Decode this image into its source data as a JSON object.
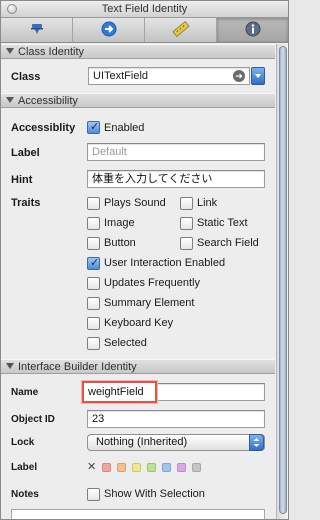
{
  "window": {
    "title": "Text Field Identity"
  },
  "toolbar": {
    "tabs": [
      {
        "icon": "attributes-icon"
      },
      {
        "icon": "connections-icon"
      },
      {
        "icon": "size-ruler-icon"
      },
      {
        "icon": "info-icon"
      }
    ],
    "active_tab": 3
  },
  "class_identity": {
    "header": "Class Identity",
    "class_label": "Class",
    "class_value": "UITextField"
  },
  "accessibility": {
    "header": "Accessibility",
    "accessibility_label": "Accessiblity",
    "enabled_label": "Enabled",
    "enabled_checked": true,
    "label_label": "Label",
    "label_placeholder": "Default",
    "hint_label": "Hint",
    "hint_value": "体重を入力してください",
    "traits_label": "Traits",
    "traits": [
      {
        "label": "Plays Sound",
        "checked": false
      },
      {
        "label": "Link",
        "checked": false
      },
      {
        "label": "Image",
        "checked": false
      },
      {
        "label": "Static Text",
        "checked": false
      },
      {
        "label": "Button",
        "checked": false
      },
      {
        "label": "Search Field",
        "checked": false
      },
      {
        "label": "User Interaction Enabled",
        "checked": true
      },
      {
        "label": "Updates Frequently",
        "checked": false
      },
      {
        "label": "Summary Element",
        "checked": false
      },
      {
        "label": "Keyboard Key",
        "checked": false
      },
      {
        "label": "Selected",
        "checked": false
      }
    ]
  },
  "ib_identity": {
    "header": "Interface Builder Identity",
    "name_label": "Name",
    "name_value": "weightField",
    "object_id_label": "Object ID",
    "object_id_value": "23",
    "lock_label": "Lock",
    "lock_value": "Nothing (Inherited)",
    "color_label_label": "Label",
    "color_none_glyph": "✕",
    "color_swatches": [
      "#f2a39a",
      "#f5c08a",
      "#efe98c",
      "#b9e38e",
      "#9fc4f2",
      "#d6a8e8",
      "#c6c6c6"
    ],
    "notes_label": "Notes",
    "show_with_selection_label": "Show With Selection",
    "show_with_selection_checked": false
  },
  "colors": {
    "focus_ring": "#e2544a",
    "checkbox_checked": "#4f8cda",
    "header_bg": "#d4d4d4"
  }
}
